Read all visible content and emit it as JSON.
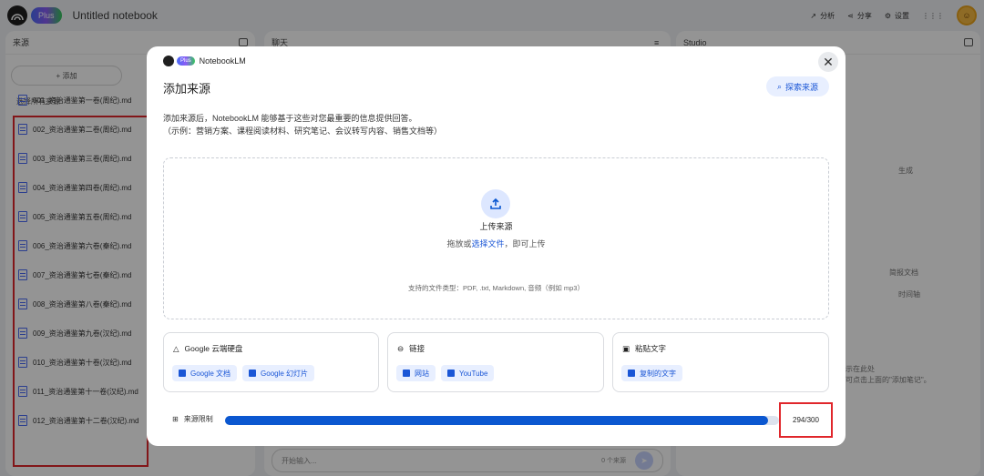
{
  "app": {
    "plus_badge": "Plus",
    "notebook_title": "Untitled notebook",
    "actions": [
      {
        "label": "分析",
        "icon": "trending-icon"
      },
      {
        "label": "分享",
        "icon": "share-icon"
      },
      {
        "label": "设置",
        "icon": "gear-icon"
      }
    ]
  },
  "left_panel": {
    "title": "来源",
    "add_label": "+ 添加",
    "select_all": "选择所有来源",
    "sources": [
      "001_资治通鉴第一卷(周纪).md",
      "002_资治通鉴第二卷(周纪).md",
      "003_资治通鉴第三卷(周纪).md",
      "004_资治通鉴第四卷(周纪).md",
      "005_资治通鉴第五卷(周纪).md",
      "006_资治通鉴第六卷(秦纪).md",
      "007_资治通鉴第七卷(秦纪).md",
      "008_资治通鉴第八卷(秦纪).md",
      "009_资治通鉴第九卷(汉纪).md",
      "010_资治通鉴第十卷(汉纪).md",
      "011_资治通鉴第十一卷(汉纪).md",
      "012_资治通鉴第十二卷(汉纪).md"
    ]
  },
  "mid_panel": {
    "title": "聊天",
    "input_placeholder": "开始输入...",
    "source_count": "0 个来源"
  },
  "right_panel": {
    "title": "Studio",
    "generate": "生成",
    "study_guide": "简报文档",
    "timeline": "时间轴",
    "note_hint_1": "示在此处",
    "note_hint_2": "可点击上面的\"添加笔记\"。"
  },
  "modal": {
    "brand": "NotebookLM",
    "plus_badge": "Plus",
    "title": "添加来源",
    "explore_button": "探索来源",
    "description_line1": "添加来源后，NotebookLM 能够基于这些对您最重要的信息提供回答。",
    "description_line2": "（示例：营销方案、课程阅读材料、研究笔记、会议转写内容、销售文档等）",
    "upload_title": "上传来源",
    "upload_sub_prefix": "拖放或",
    "upload_sub_link": "选择文件",
    "upload_sub_suffix": "，即可上传",
    "supported_types": "支持的文件类型：PDF, .txt, Markdown, 音频（例如 mp3）",
    "cards": [
      {
        "title": "Google 云端硬盘",
        "icon": "drive-icon",
        "chips": [
          "Google 文档",
          "Google 幻灯片"
        ]
      },
      {
        "title": "链接",
        "icon": "link-icon",
        "chips": [
          "网站",
          "YouTube"
        ]
      },
      {
        "title": "粘贴文字",
        "icon": "clipboard-icon",
        "chips": [
          "复制的文字"
        ]
      }
    ],
    "limit_label": "来源限制",
    "limit_used": 294,
    "limit_max": 300,
    "limit_text": "294/300"
  }
}
